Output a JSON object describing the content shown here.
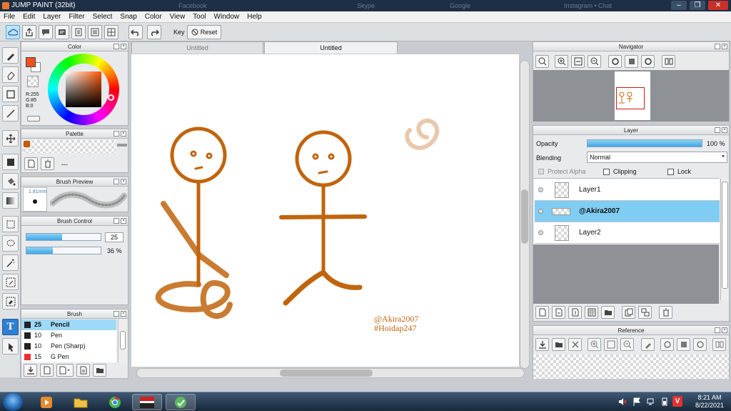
{
  "window": {
    "title": "JUMP PAINT (32bit)",
    "background_tabs": [
      "Facebook",
      "Skype",
      "Google",
      "Instagram • Chat"
    ]
  },
  "menu": [
    "File",
    "Edit",
    "Layer",
    "Filter",
    "Select",
    "Snap",
    "Color",
    "View",
    "Tool",
    "Window",
    "Help"
  ],
  "toolbar": {
    "key_label": "Key",
    "reset_label": "Reset"
  },
  "color_panel": {
    "title": "Color",
    "main_color": "#f0501e",
    "sub_color": "#ffffff",
    "rgb_r": "R:255",
    "rgb_g": "G:85",
    "rgb_b": "B:0"
  },
  "palette_panel": {
    "title": "Palette",
    "swatch_color": "#c45c0c",
    "dash": "---"
  },
  "brush_preview": {
    "title": "Brush Preview",
    "size_label": "1.81mm"
  },
  "brush_control": {
    "title": "Brush Control",
    "size_value": "25",
    "size_fraction": 0.48,
    "opacity_value": "36 %",
    "opacity_fraction": 0.36
  },
  "brush_panel": {
    "title": "Brush",
    "items": [
      {
        "size": "25",
        "name": "Pencil",
        "selected": true,
        "color": "#222222"
      },
      {
        "size": "10",
        "name": "Pen",
        "selected": false,
        "color": "#222222"
      },
      {
        "size": "10",
        "name": "Pen (Sharp)",
        "selected": false,
        "color": "#222222"
      },
      {
        "size": "15",
        "name": "G Pen",
        "selected": false,
        "color": "#e83030"
      }
    ]
  },
  "tabs": [
    {
      "label": "Untitled",
      "active": false
    },
    {
      "label": "Untitled",
      "active": true
    }
  ],
  "canvas": {
    "stroke_color": "#c0650d",
    "watermark_line1": "@Akira2007",
    "watermark_line2": "#Hoidap247"
  },
  "navigator": {
    "title": "Navigator"
  },
  "layer_panel": {
    "title": "Layer",
    "opacity_label": "Opacity",
    "opacity_value": "100 %",
    "opacity_fraction": 1.0,
    "blending_label": "Blending",
    "blending_value": "Normal",
    "protect_alpha": "Protect Alpha",
    "clipping": "Clipping",
    "lock": "Lock",
    "layers": [
      {
        "name": "Layer1",
        "selected": false,
        "bold": false
      },
      {
        "name": "@Akira2007",
        "selected": true,
        "bold": true
      },
      {
        "name": "Layer2",
        "selected": false,
        "bold": false
      }
    ]
  },
  "reference": {
    "title": "Reference"
  },
  "taskbar": {
    "time": "8:21 AM",
    "date": "8/22/2021"
  }
}
